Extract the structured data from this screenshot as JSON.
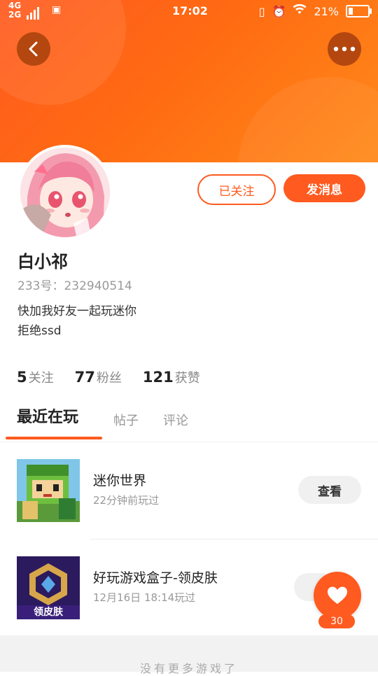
{
  "status_bar": {
    "network_top": "4G",
    "network_bottom": "2G",
    "time": "17:02",
    "battery": "21%"
  },
  "profile": {
    "name": "白小祁",
    "uid_label": "233号：",
    "uid": "232940514",
    "bio_line1": "快加我好友一起玩迷你",
    "bio_line2": "拒绝ssd",
    "follow_button": "已关注",
    "message_button": "发消息",
    "stats": [
      {
        "value": "5",
        "label": "关注"
      },
      {
        "value": "77",
        "label": "粉丝"
      },
      {
        "value": "121",
        "label": "获赞"
      }
    ]
  },
  "tabs": [
    {
      "label": "最近在玩"
    },
    {
      "label": "帖子"
    },
    {
      "label": "评论"
    }
  ],
  "games": [
    {
      "name": "迷你世界",
      "subtitle": "22分钟前玩过",
      "button": "查看"
    },
    {
      "name": "好玩游戏盒子-领皮肤",
      "subtitle": "12月16日 18:14玩过",
      "badge": "领皮肤"
    }
  ],
  "footer_text": "没有更多游戏了",
  "like_count": "30",
  "colors": {
    "accent": "#ff5a1f",
    "hero_start": "#ff5a1f",
    "hero_end": "#ff8a1a"
  }
}
